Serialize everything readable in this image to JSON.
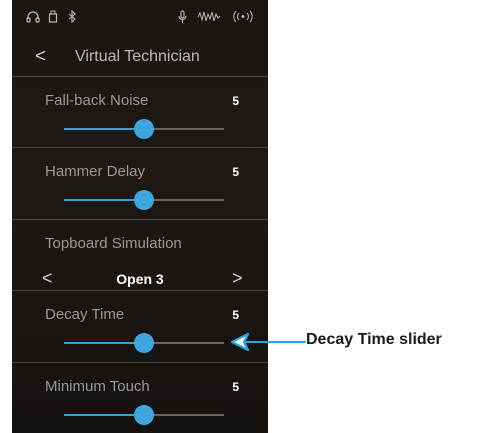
{
  "status_bar": {
    "icons": [
      "headphones-icon",
      "usb-icon",
      "bluetooth-icon",
      "microphone-icon",
      "sound-wave-icon",
      "wireless-icon"
    ]
  },
  "header": {
    "back_glyph": "<",
    "title": "Virtual Technician"
  },
  "rows": [
    {
      "label": "Fall-back Noise",
      "value": "5",
      "slider_fraction": 0.5
    },
    {
      "label": "Hammer Delay",
      "value": "5",
      "slider_fraction": 0.5
    },
    {
      "label": "Topboard Simulation",
      "selected": "Open 3",
      "prev_glyph": "<",
      "next_glyph": ">"
    },
    {
      "label": "Decay Time",
      "value": "5",
      "slider_fraction": 0.5
    },
    {
      "label": "Minimum Touch",
      "value": "5",
      "slider_fraction": 0.5
    }
  ],
  "annotation": {
    "label": "Decay Time slider",
    "color": "#29a8e0"
  }
}
